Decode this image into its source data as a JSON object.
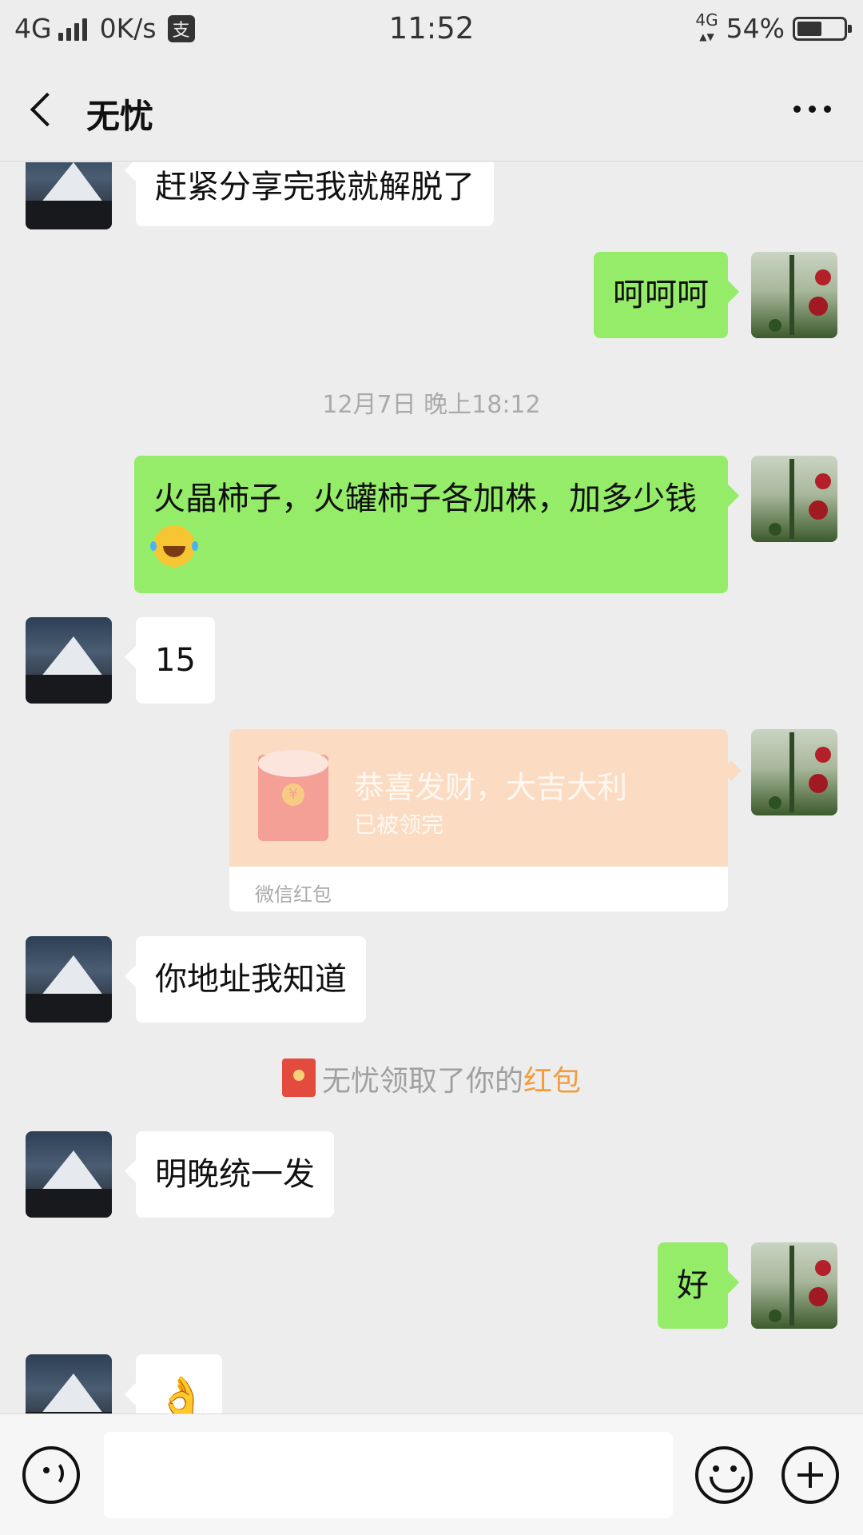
{
  "status_bar": {
    "network": "4G",
    "speed": "0K/s",
    "pay_icon": "支",
    "time": "11:52",
    "network_right": "4G",
    "battery_percent": "54%",
    "battery_level": 0.54
  },
  "header": {
    "back_icon": "chevron-left-icon",
    "title": "无忧",
    "more_icon": "more-dots-icon"
  },
  "messages": [
    {
      "side": "left",
      "text": "赶紧分享完我就解脱了"
    },
    {
      "side": "right",
      "text": "呵呵呵"
    },
    {
      "type": "time",
      "text": "12月7日 晚上18:12"
    },
    {
      "side": "right",
      "text": "火晶柿子，火罐柿子各加株，加多少钱",
      "emoji": "laughing-tears-emoji"
    },
    {
      "side": "left",
      "text": "15"
    },
    {
      "side": "right",
      "type": "red_packet",
      "title": "恭喜发财，大吉大利",
      "status": "已被领完",
      "footer": "微信红包"
    },
    {
      "side": "left",
      "text": "你地址我知道"
    },
    {
      "type": "system",
      "text": "无忧领取了你的",
      "link": "红包"
    },
    {
      "side": "left",
      "text": "明晚统一发"
    },
    {
      "side": "right",
      "text": "好"
    },
    {
      "side": "left",
      "emoji": "ok-hand-emoji",
      "glyph": "👌"
    }
  ],
  "input_bar": {
    "voice_icon": "voice-icon",
    "emoji_icon": "emoji-icon",
    "plus_icon": "plus-icon",
    "input_value": ""
  }
}
